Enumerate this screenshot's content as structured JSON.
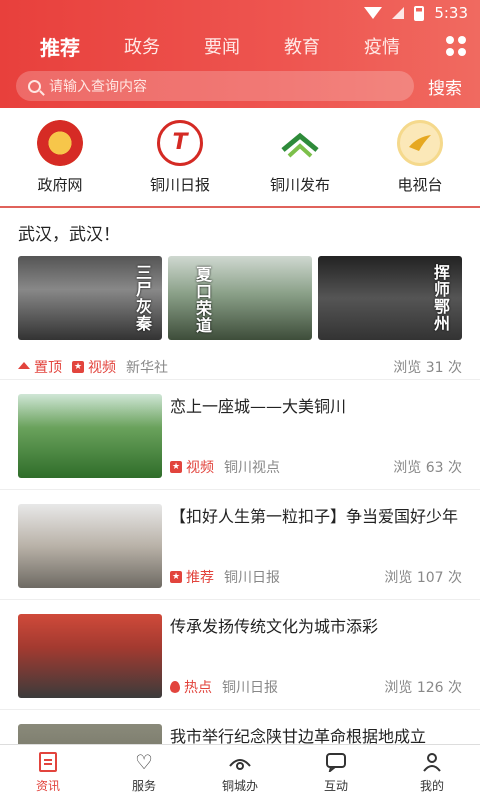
{
  "status_bar": {
    "time": "5:33"
  },
  "header": {
    "tabs": [
      {
        "label": "推荐",
        "active": true
      },
      {
        "label": "政务"
      },
      {
        "label": "要闻"
      },
      {
        "label": "教育"
      },
      {
        "label": "疫情"
      }
    ],
    "search": {
      "placeholder": "请输入查询内容",
      "button": "搜索"
    }
  },
  "quick_links": [
    {
      "label": "政府网",
      "icon": "national-emblem-icon"
    },
    {
      "label": "铜川日报",
      "icon": "tongchuan-daily-logo",
      "glyph": "T"
    },
    {
      "label": "铜川发布",
      "icon": "tongchuan-release-logo"
    },
    {
      "label": "电视台",
      "icon": "tv-station-logo"
    }
  ],
  "lead": {
    "title": "武汉，武汉！",
    "images": [
      {
        "caption": "三尸灰秦"
      },
      {
        "caption": "夏口荣道"
      },
      {
        "caption": "挥师鄂州"
      }
    ],
    "tags": [
      "置顶",
      "视频"
    ],
    "source": "新华社",
    "views": "浏览 31 次"
  },
  "articles": [
    {
      "title": "恋上一座城——大美铜川",
      "tag": "视频",
      "source": "铜川视点",
      "views": "浏览 63 次"
    },
    {
      "title": "【扣好人生第一粒扣子】争当爱国好少年",
      "tag": "推荐",
      "source": "铜川日报",
      "views": "浏览 107 次"
    },
    {
      "title": "传承发扬传统文化为城市添彩",
      "tag": "热点",
      "source": "铜川日报",
      "views": "浏览 126 次"
    },
    {
      "title": "我市举行纪念陕甘边革命根据地成立"
    }
  ],
  "bottom_nav": [
    {
      "label": "资讯",
      "active": true
    },
    {
      "label": "服务"
    },
    {
      "label": "铜城办"
    },
    {
      "label": "互动"
    },
    {
      "label": "我的"
    }
  ],
  "colors": {
    "brand": "#e8403c",
    "tag": "#e2443d"
  }
}
